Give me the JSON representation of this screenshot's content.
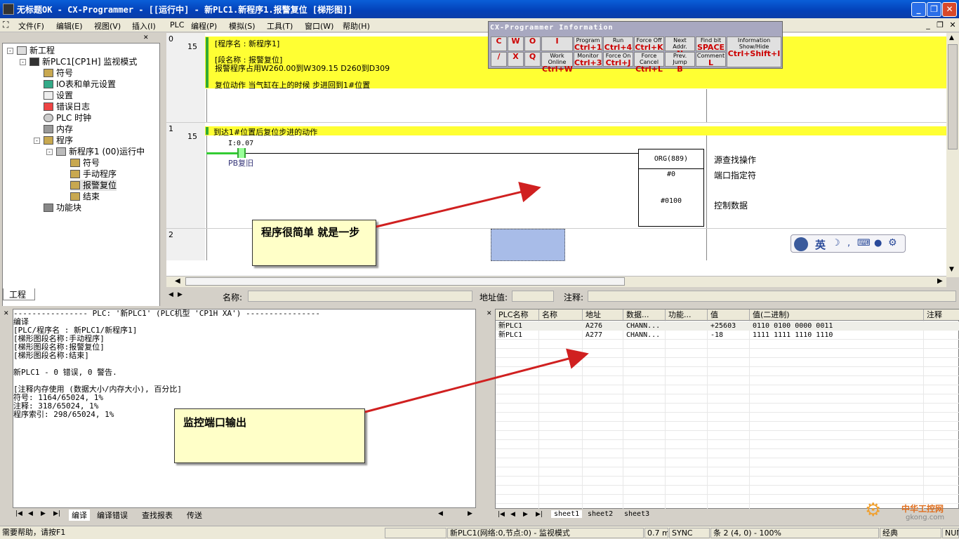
{
  "window": {
    "title": "无标题OK - CX-Programmer - [[运行中] - 新PLC1.新程序1.报警复位 [梯形图]]"
  },
  "menu": [
    "文件(F)",
    "编辑(E)",
    "视图(V)",
    "插入(I)",
    "PLC",
    "编程(P)",
    "模拟(S)",
    "工具(T)",
    "窗口(W)",
    "帮助(H)"
  ],
  "tree": {
    "root": "新工程",
    "plc": "新PLC1[CP1H] 监视模式",
    "items": [
      "符号",
      "IO表和单元设置",
      "设置",
      "错误日志",
      "PLC 时钟",
      "内存",
      "程序"
    ],
    "program": "新程序1 (00)运行中",
    "sub": [
      "符号",
      "手动程序",
      "报警复位",
      "结束"
    ],
    "func": "功能块",
    "tab": "工程"
  },
  "ladder": {
    "r0": {
      "num": "0",
      "steps": "15",
      "l1": "[程序名 : 新程序1]",
      "l2": "[段名称 : 报警复位]",
      "l3": "报警程序占用W260.00到W309.15 D260到D309",
      "l4": "复位动作 当气缸在上的时候 步进回到1#位置"
    },
    "r1": {
      "num": "1",
      "steps": "15",
      "comment": "到达1#位置后复位步进的动作",
      "contact_addr": "I:0.07",
      "contact_name": "PB复旧",
      "instr": "ORG(889)",
      "op1": "#0",
      "op2": "#0100",
      "c1": "源查找操作",
      "c2": "端口指定符",
      "c3": "控制数据"
    },
    "r2": {
      "num": "2"
    }
  },
  "info": {
    "title": "CX-Programmer Information",
    "keys": [
      {
        "t": "",
        "k": "C"
      },
      {
        "t": "",
        "k": "W"
      },
      {
        "t": "",
        "k": "O"
      },
      {
        "t": "",
        "k": "I"
      },
      {
        "t": "Program",
        "k": "Ctrl+1"
      },
      {
        "t": "Run",
        "k": "Ctrl+4"
      },
      {
        "t": "Force Off",
        "k": "Ctrl+K"
      },
      {
        "t": "Next Addr.",
        "k": "N"
      },
      {
        "t": "Find bit",
        "k": "SPACE"
      },
      {
        "t": "Information Show/Hide",
        "k": "Ctrl+Shift+I"
      },
      {
        "t": "",
        "k": "/"
      },
      {
        "t": "",
        "k": "X"
      },
      {
        "t": "",
        "k": "Q"
      },
      {
        "t": "Work Online",
        "k": "Ctrl+W"
      },
      {
        "t": "Monitor",
        "k": "Ctrl+3"
      },
      {
        "t": "Force On",
        "k": "Ctrl+J"
      },
      {
        "t": "Force Cancel",
        "k": "Ctrl+L"
      },
      {
        "t": "Prev. Jump",
        "k": "B"
      },
      {
        "t": "Comment",
        "k": "L"
      }
    ]
  },
  "midbar": {
    "name": "名称:",
    "addr": "地址值:",
    "comment": "注释:"
  },
  "output": {
    "header": "---------------- PLC: '新PLC1' (PLC机型 'CP1H XA') ----------------",
    "lines": [
      "编译",
      "[PLC/程序名 : 新PLC1/新程序1]",
      "[梯形图段名称:手动程序]",
      "[梯形图段名称:报警复位]",
      "[梯形图段名称:结束]",
      "",
      "新PLC1 - 0 错误, 0 警告.",
      "",
      "[注释内存使用 (数据大小/内存大小), 百分比]",
      "符号: 1164/65024, 1%",
      "注释: 318/65024, 1%",
      "程序索引: 298/65024, 1%"
    ],
    "tabs": [
      "编译",
      "编译错误",
      "查找报表",
      "传送"
    ]
  },
  "watch": {
    "headers": [
      "PLC名称",
      "名称",
      "地址",
      "数据...",
      "功能...",
      "值",
      "值(二进制)",
      "注释"
    ],
    "rows": [
      [
        "新PLC1",
        "",
        "A276",
        "CHANN...",
        "",
        "+25603",
        "0110 0100 0000 0011",
        ""
      ],
      [
        "新PLC1",
        "",
        "A277",
        "CHANN...",
        "",
        "-18",
        "1111 1111 1110 1110",
        ""
      ]
    ],
    "tabs": [
      "sheet1",
      "sheet2",
      "sheet3"
    ]
  },
  "callouts": {
    "a": "程序很简单 就是一步",
    "b": "监控端口输出"
  },
  "ime": "英",
  "status": {
    "help": "需要帮助，请按F1",
    "net": "新PLC1(网络:0,节点:0) - 监视模式",
    "time": "0.7 m",
    "sync": "SYNC",
    "pos": "条 2 (4, 0) - 100%",
    "mode": "经典",
    "num": "NUM"
  },
  "watermark": {
    "brand": "中华工控网",
    "url": "gkong.com"
  }
}
